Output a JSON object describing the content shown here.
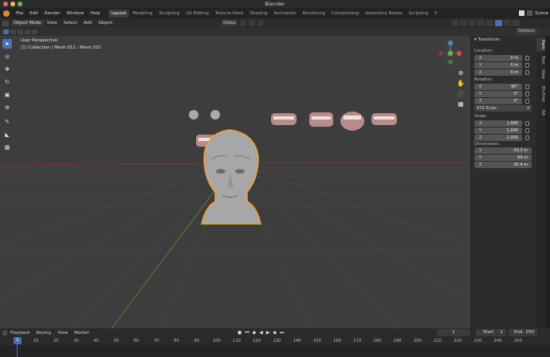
{
  "window": {
    "title": "Blender"
  },
  "menu": [
    "File",
    "Edit",
    "Render",
    "Window",
    "Help"
  ],
  "workspaces": [
    "Layout",
    "Modeling",
    "Sculpting",
    "UV Editing",
    "Texture Paint",
    "Shading",
    "Animation",
    "Rendering",
    "Compositing",
    "Geometry Nodes",
    "Scripting"
  ],
  "workspace_add": "+",
  "scene_label": "Scene",
  "header": {
    "mode": "Object Mode",
    "menus": [
      "View",
      "Select",
      "Add",
      "Object"
    ],
    "transform_orientation": "Global",
    "options_label": "Options"
  },
  "viewport": {
    "view_name": "User Perspective",
    "collection_info": "(1) Collection | Mesh.012 : Mesh.031"
  },
  "sidebar": {
    "panel_title": "Transform",
    "location_label": "Location:",
    "location": [
      {
        "axis": "X",
        "value": "0 m"
      },
      {
        "axis": "Y",
        "value": "0 m"
      },
      {
        "axis": "Z",
        "value": "0 m"
      }
    ],
    "rotation_label": "Rotation:",
    "rotation": [
      {
        "axis": "X",
        "value": "90°"
      },
      {
        "axis": "Y",
        "value": "0°"
      },
      {
        "axis": "Z",
        "value": "0°"
      }
    ],
    "rotation_mode": "XYZ Euler",
    "scale_label": "Scale:",
    "scale": [
      {
        "axis": "X",
        "value": "1.000"
      },
      {
        "axis": "Y",
        "value": "1.000"
      },
      {
        "axis": "Z",
        "value": "1.000"
      }
    ],
    "dimensions_label": "Dimensions:",
    "dimensions": [
      {
        "axis": "X",
        "value": "43.3 m"
      },
      {
        "axis": "Y",
        "value": "69 m"
      },
      {
        "axis": "Z",
        "value": "45.4 m"
      }
    ],
    "tabs": [
      "Item",
      "Tool",
      "View",
      "3D-Print",
      "RA"
    ]
  },
  "timeline": {
    "menus": [
      "Playback",
      "Keying",
      "View",
      "Marker"
    ],
    "current_frame": "1",
    "start_label": "Start",
    "start": "1",
    "end_label": "End",
    "end": "250",
    "ruler_current": "1",
    "ticks": [
      "10",
      "20",
      "30",
      "40",
      "50",
      "60",
      "70",
      "80",
      "90",
      "100",
      "110",
      "120",
      "130",
      "140",
      "150",
      "160",
      "170",
      "180",
      "190",
      "200",
      "210",
      "220",
      "230",
      "240",
      "250"
    ]
  }
}
